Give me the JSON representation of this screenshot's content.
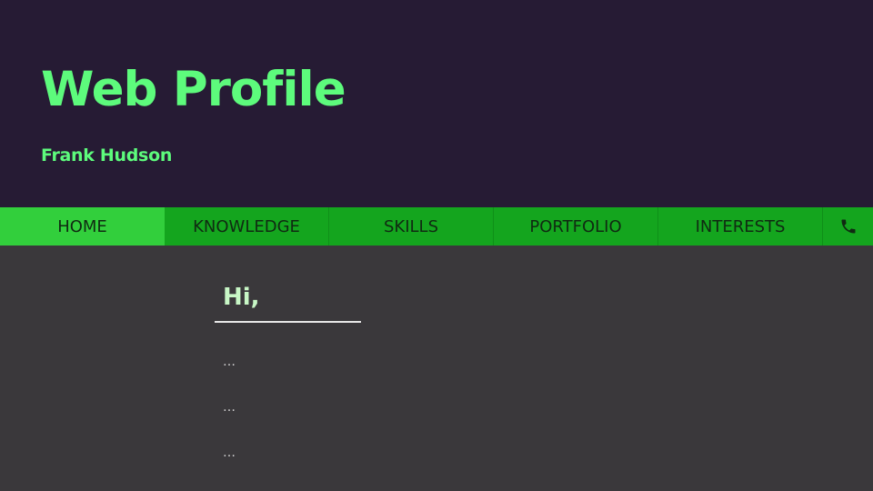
{
  "header": {
    "title": "Web Profile",
    "author": "Frank Hudson"
  },
  "nav": {
    "items": [
      {
        "label": "HOME",
        "active": true
      },
      {
        "label": "KNOWLEDGE",
        "active": false
      },
      {
        "label": "SKILLS",
        "active": false
      },
      {
        "label": "PORTFOLIO",
        "active": false
      },
      {
        "label": "INTERESTS",
        "active": false
      }
    ],
    "contact_icon": "phone-icon"
  },
  "main": {
    "greeting": "Hi,",
    "lines": [
      "…",
      "…",
      "…"
    ]
  },
  "colors": {
    "header_bg": "#261b34",
    "accent_text": "#5dfb7c",
    "nav_bg": "#14a51e",
    "nav_active_bg": "#32cf3c",
    "body_bg": "#3a383b"
  }
}
